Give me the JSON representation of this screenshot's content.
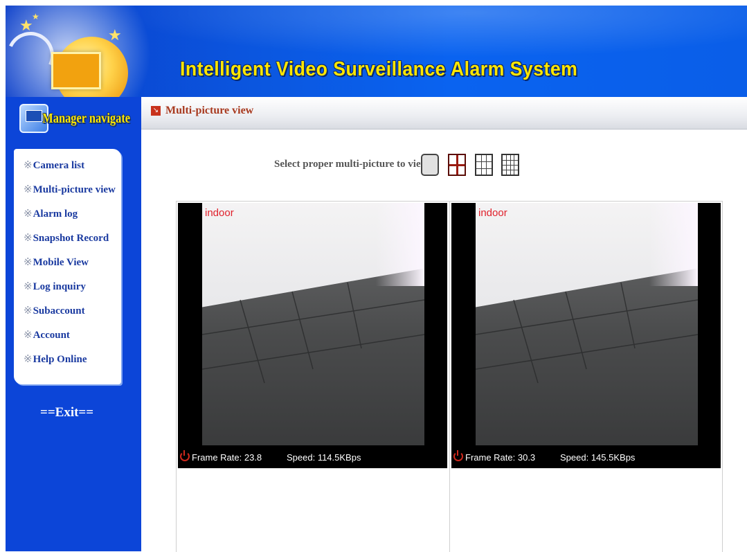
{
  "header": {
    "title": "Intelligent Video Surveillance Alarm System"
  },
  "sidebar": {
    "heading": "Manager navigate",
    "items": [
      {
        "label": "Camera list"
      },
      {
        "label": "Multi-picture view"
      },
      {
        "label": "Alarm log"
      },
      {
        "label": "Snapshot Record"
      },
      {
        "label": "Mobile View"
      },
      {
        "label": "Log inquiry"
      },
      {
        "label": "Subaccount"
      },
      {
        "label": "Account"
      },
      {
        "label": "Help Online"
      }
    ],
    "bullet": "※",
    "exit": "==Exit=="
  },
  "page": {
    "title": "Multi-picture view",
    "select_label": "Select proper multi-picture to view:",
    "layouts": [
      "1",
      "4",
      "9",
      "16"
    ],
    "selected_layout": "4"
  },
  "cameras": [
    {
      "name": "indoor",
      "frame_rate": "Frame Rate: 23.8",
      "speed": "Speed: 114.5KBps"
    },
    {
      "name": "indoor",
      "frame_rate": "Frame Rate: 30.3",
      "speed": "Speed: 145.5KBps"
    }
  ],
  "colors": {
    "sidebar_bg": "#0c45d8",
    "title_yellow": "#ffe600",
    "accent_red": "#a8391e",
    "overlay_red": "#e0202b"
  }
}
